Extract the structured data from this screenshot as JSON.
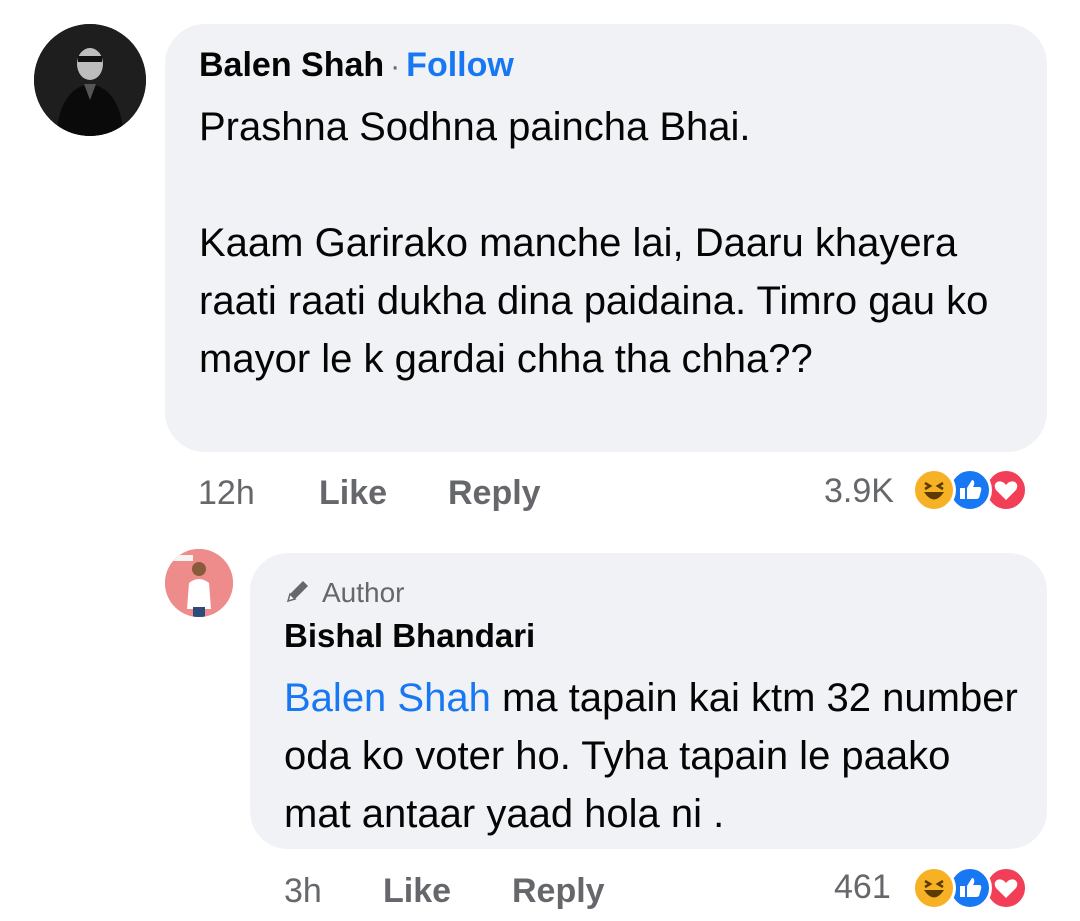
{
  "comment": {
    "author": "Balen Shah",
    "separator": "·",
    "follow_label": "Follow",
    "text": "Prashna Sodhna paincha Bhai.\n\nKaam Garirako manche lai, Daaru khayera raati raati dukha dina paidaina. Timro gau ko mayor le k gardai chha tha chha??",
    "time": "12h",
    "like_label": "Like",
    "reply_label": "Reply",
    "reaction_count": "3.9K",
    "reactions": [
      "haha-icon",
      "like-icon",
      "love-icon"
    ]
  },
  "reply": {
    "badge": "Author",
    "author": "Bishal Bhandari",
    "mention": "Balen Shah",
    "text": " ma tapain kai ktm 32 number oda ko voter ho. Tyha tapain le paako mat antaar yaad hola ni .",
    "time": "3h",
    "like_label": "Like",
    "reply_label": "Reply",
    "reaction_count": "461",
    "reactions": [
      "haha-icon",
      "like-icon",
      "love-icon"
    ]
  },
  "colors": {
    "bubble": "#f0f2f5",
    "link": "#1877f2",
    "meta": "#65676b",
    "haha": "#f7b125",
    "like": "#1877f2",
    "love": "#f33e58"
  }
}
